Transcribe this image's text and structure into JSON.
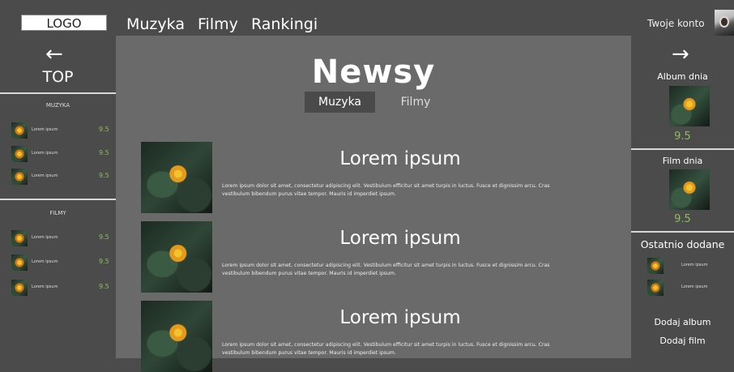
{
  "header": {
    "logo": "LOGO",
    "nav": [
      "Muzyka",
      "Filmy",
      "Rankingi"
    ],
    "account": "Twoje konto"
  },
  "left": {
    "arrow": "←",
    "top_label": "TOP",
    "music": {
      "title": "MUZYKA",
      "items": [
        {
          "name": "Lorem ipsum",
          "score": "9.5"
        },
        {
          "name": "Lorem ipsum",
          "score": "9.5"
        },
        {
          "name": "Lorem ipsum",
          "score": "9.5"
        }
      ]
    },
    "films": {
      "title": "FILMY",
      "items": [
        {
          "name": "Lorem ipsum",
          "score": "9.5"
        },
        {
          "name": "Lorem ipsum",
          "score": "9.5"
        },
        {
          "name": "Lorem ipsum",
          "score": "9.5"
        }
      ]
    }
  },
  "main": {
    "title": "Newsy",
    "tabs": [
      "Muzyka",
      "Filmy"
    ],
    "news": [
      {
        "title": "Lorem ipsum",
        "text": "Lorem ipsum dolor sit amet, consectetur adipiscing elit. Vestibulum efficitur sit amet turpis in luctus. Fusce et dignissim arcu. Cras vestibulum bibendum purus vitae tempor. Mauris id imperdiet ipsum."
      },
      {
        "title": "Lorem ipsum",
        "text": "Lorem ipsum dolor sit amet, consectetur adipiscing elit. Vestibulum efficitur sit amet turpis in luctus. Fusce et dignissim arcu. Cras vestibulum bibendum purus vitae tempor. Mauris id imperdiet ipsum."
      },
      {
        "title": "Lorem ipsum",
        "text": "Lorem ipsum dolor sit amet, consectetur adipiscing elit. Vestibulum efficitur sit amet turpis in luctus. Fusce et dignissim arcu. Cras vestibulum bibendum purus vitae tempor. Mauris id imperdiet ipsum."
      }
    ]
  },
  "right": {
    "arrow": "→",
    "album_title": "Album dnia",
    "album_score": "9.5",
    "film_title": "Film dnia",
    "film_score": "9.5",
    "recent_title": "Ostatnio dodane",
    "recent": [
      {
        "name": "Lorem ipsum"
      },
      {
        "name": "Lorem ipsum"
      }
    ],
    "add_album": "Dodaj album",
    "add_film": "Dodaj film"
  },
  "colors": {
    "background": "#4b4b4b",
    "main_panel": "#6a6a6a",
    "score_green": "#8cbf5a"
  }
}
